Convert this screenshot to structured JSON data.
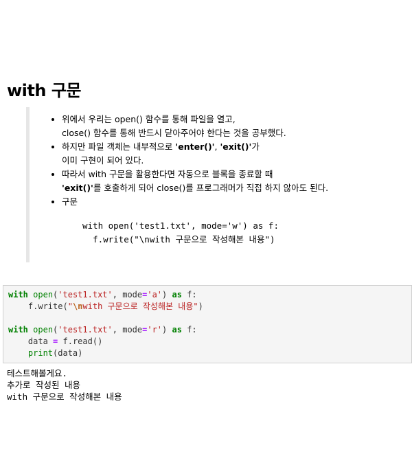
{
  "heading": "with 구문",
  "notes": {
    "items": [
      {
        "line1": "위에서 우리는 open() 함수를 통해 파일을 열고,",
        "line2": "close() 함수를 통해 반드시 닫아주어야 한다는 것을 공부했다."
      },
      {
        "line1_pre": "하지만 파일 객체는 내부적으로 ",
        "line1_b1": "'enter()'",
        "line1_mid": ", ",
        "line1_b2": "'exit()'",
        "line1_post": "가",
        "line2": "이미 구현이 되어 있다."
      },
      {
        "line1": "따라서 with 구문을 활용한다면 자동으로 블록을 종료할 때",
        "line2_b": "'exit()'",
        "line2_post": "를 호출하게 되어 close()를 프로그래머가 직접 하지 않아도 된다."
      },
      {
        "line1": "구문"
      }
    ],
    "example": {
      "line1": "with open('test1.txt', mode='w') as f:",
      "line2": "  f.write(\"\\nwith 구문으로 작성해본 내용\")"
    }
  },
  "code_cell": {
    "line1": {
      "kw_with": "with",
      "fn_open": "open",
      "p1": "(",
      "s_file": "'test1.txt'",
      "p2": ", mode",
      "eq": "=",
      "s_mode": "'a'",
      "p3": ") ",
      "kw_as": "as",
      "p4": " f:"
    },
    "line2": {
      "indent": "    f.write(",
      "s_open": "\"",
      "esc": "\\n",
      "s_text": "with 구문으로 작성해본 내용\"",
      "p_close": ")"
    },
    "line4": {
      "kw_with": "with",
      "fn_open": "open",
      "p1": "(",
      "s_file": "'test1.txt'",
      "p2": ", mode",
      "eq": "=",
      "s_mode": "'r'",
      "p3": ") ",
      "kw_as": "as",
      "p4": " f:"
    },
    "line5": {
      "indent": "    data ",
      "eq": "=",
      "rest": " f.read()"
    },
    "line6": {
      "indent": "    ",
      "fn_print": "print",
      "rest": "(data)"
    }
  },
  "output": {
    "lines": [
      "테스트해볼게요.",
      "추가로 작성된 내용",
      "with 구문으로 작성해본 내용"
    ]
  }
}
